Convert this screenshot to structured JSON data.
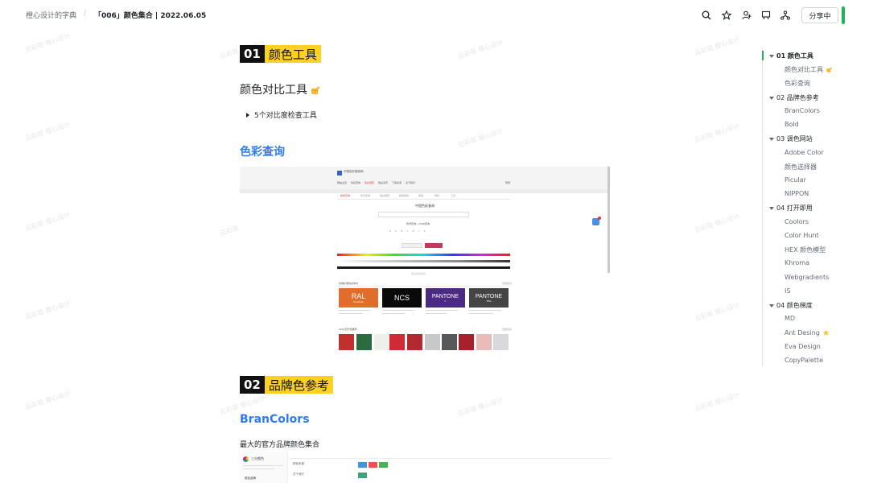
{
  "header": {
    "workspace": "橙心设计的字典",
    "separator": "/",
    "doc_title": "「006」颜色集合 | 2022.06.05",
    "share_label": "分享中",
    "icons": [
      "search-icon",
      "star-icon",
      "user-add-icon",
      "bookmark-icon",
      "share-tree-icon"
    ]
  },
  "watermark": "云彩哥 橙心设计",
  "sections": {
    "s1": {
      "num": "01",
      "title": "颜色工具"
    },
    "s1_h2": "颜色对比工具",
    "s1_toggle": "5个对比度检查工具",
    "s1_h3": "色彩查询",
    "s2": {
      "num": "02",
      "title": "品牌色参考"
    },
    "s2_h3": "BranColors",
    "s2_para": "最大的官方品牌颜色集合"
  },
  "shot1": {
    "logo": "中国色彩搜索网",
    "nav": [
      "网站主页",
      "色彩查询",
      "色彩搭配",
      "色彩资讯",
      "下载资源",
      "关于我们"
    ],
    "login": "登录",
    "tabs": [
      "颜色查询",
      "色卡查询",
      "色彩搭配",
      "颜色转换",
      "色板",
      "调色",
      "工具"
    ],
    "title": "中国色彩查询",
    "radios": "色号查询  ○ RGB查询",
    "bar_caption": "拖动选择颜色",
    "sec1_label": "中国标准色彩体系",
    "sec2_label": "2022流行色推荐",
    "more": "查看更多",
    "cards": [
      {
        "big": "RAL",
        "small": "CLASSIC",
        "color": "#e06d2b"
      },
      {
        "big": "NCS",
        "small": "",
        "color": "#0a0a0a"
      },
      {
        "big": "PANTONE",
        "small": "C",
        "color": "#4b2a84"
      },
      {
        "big": "PANTONE",
        "small": "TPG",
        "color": "#444444"
      }
    ],
    "swatches": [
      "#c0302d",
      "#2a6b3f",
      "#f0f0ea",
      "#cf2b36",
      "#b02a2f",
      "#c8c8c8",
      "#555759",
      "#a6212c",
      "#e8bcb8",
      "#d9d9d9"
    ]
  },
  "shot2": {
    "name": "三分颜色",
    "nav": "颜色品牌",
    "rows": [
      "颜色来源",
      "关于我们"
    ],
    "chips": [
      "#4a90e2",
      "#e55353",
      "#4caf50",
      "#3fa37a"
    ]
  },
  "toc": [
    {
      "label": "01 颜色工具",
      "level": 1,
      "active": true
    },
    {
      "label": "颜色对比工具",
      "level": 2,
      "emoji": "hand"
    },
    {
      "label": "色彩查询",
      "level": 2
    },
    {
      "label": "02 品牌色参考",
      "level": 1
    },
    {
      "label": "BranColors",
      "level": 2
    },
    {
      "label": "Bold",
      "level": 2
    },
    {
      "label": "03 调色网站",
      "level": 1
    },
    {
      "label": "Adobe Color",
      "level": 2
    },
    {
      "label": "颜色选择器",
      "level": 2
    },
    {
      "label": "Picular",
      "level": 2
    },
    {
      "label": "NIPPON",
      "level": 2
    },
    {
      "label": "04 打开即用",
      "level": 1
    },
    {
      "label": "Coolors",
      "level": 2
    },
    {
      "label": "Color Hunt",
      "level": 2
    },
    {
      "label": "HEX 颜色模型",
      "level": 2
    },
    {
      "label": "Khroma",
      "level": 2
    },
    {
      "label": "Webgradients",
      "level": 2
    },
    {
      "label": "IS",
      "level": 2
    },
    {
      "label": "04 颜色梯度",
      "level": 1
    },
    {
      "label": "MD",
      "level": 2
    },
    {
      "label": "Ant Desing",
      "level": 2,
      "emoji": "star"
    },
    {
      "label": "Eva Design",
      "level": 2
    },
    {
      "label": "CopyPalette",
      "level": 2
    }
  ],
  "colors": {
    "accent_green": "#1eb35a",
    "heading_blue": "#2f7bea",
    "highlight_yellow": "#fcd21f"
  }
}
